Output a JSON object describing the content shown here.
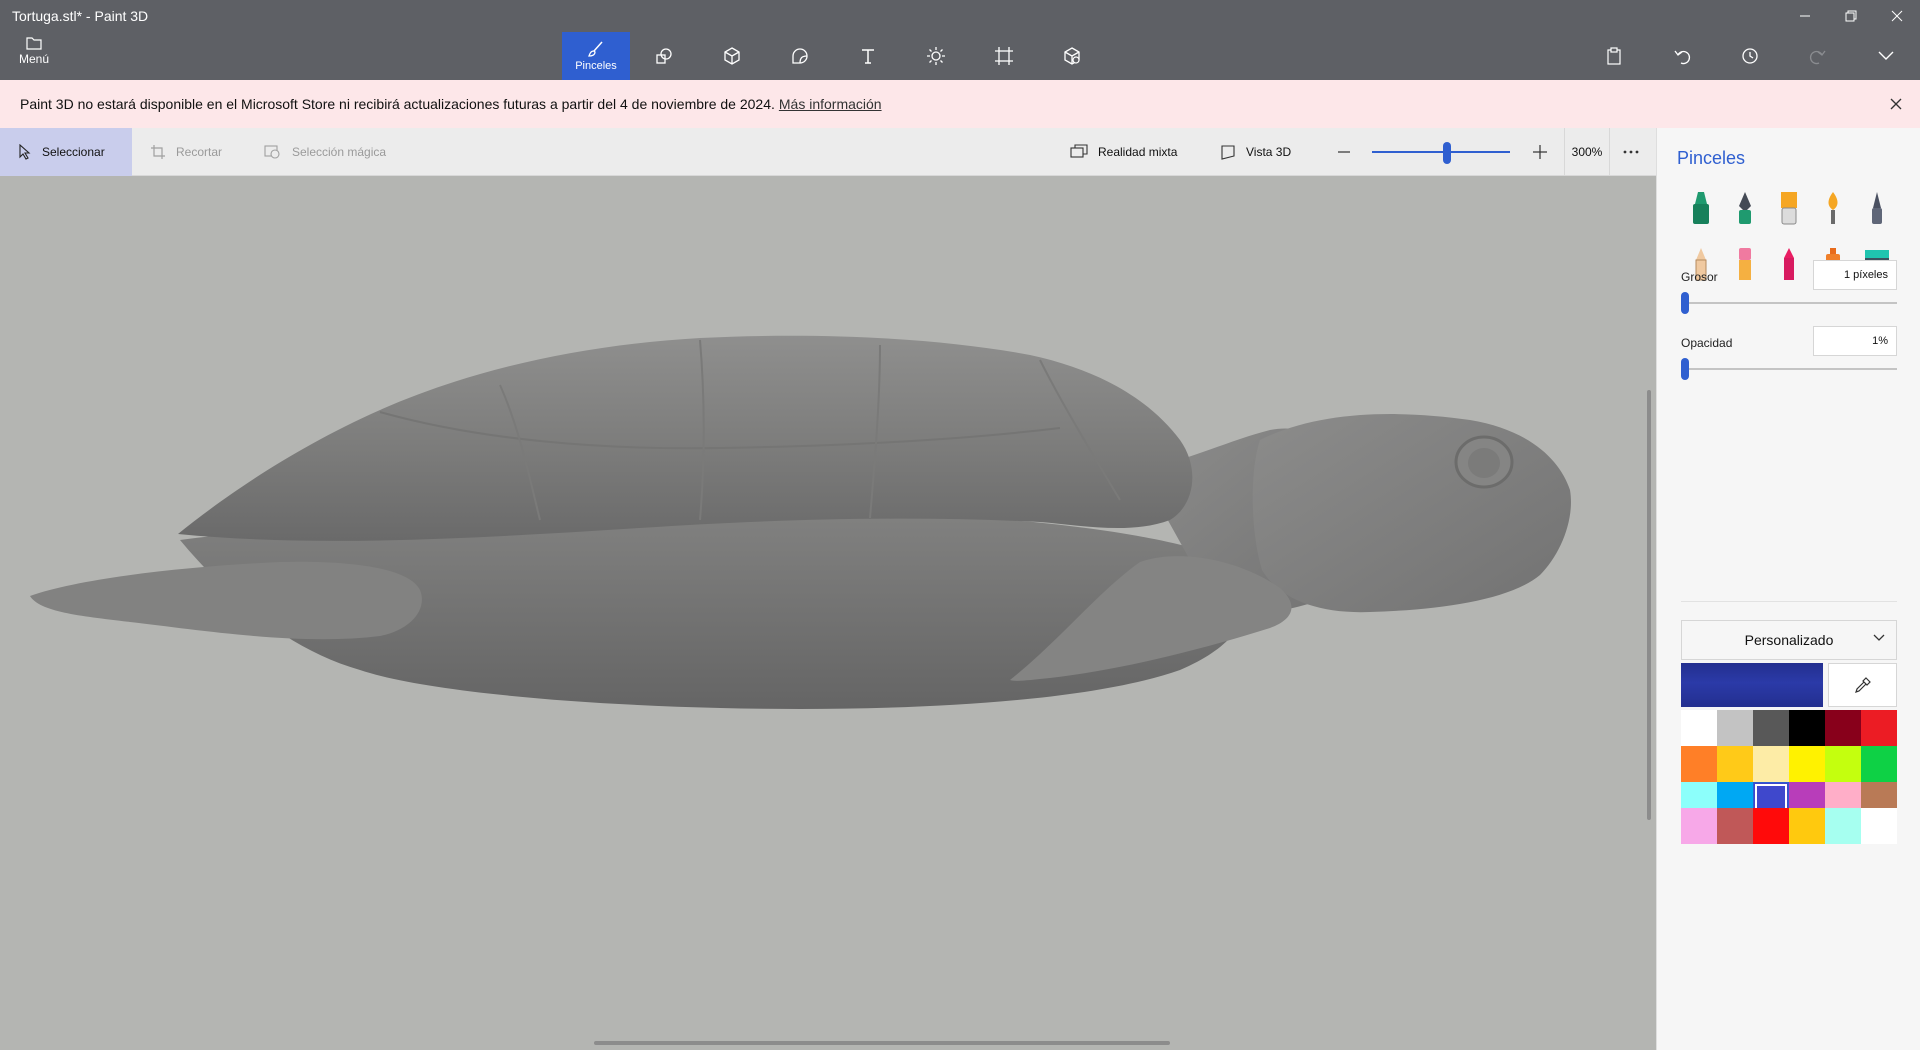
{
  "window": {
    "title": "Tortuga.stl* - Paint 3D"
  },
  "menu": {
    "label": "Menú"
  },
  "toolbar": {
    "tools": [
      {
        "label": "Pinceles",
        "icon": "brush-icon",
        "active": true
      },
      {
        "label": "",
        "icon": "shapes-2d-icon"
      },
      {
        "label": "",
        "icon": "shapes-3d-icon"
      },
      {
        "label": "",
        "icon": "stickers-icon"
      },
      {
        "label": "",
        "icon": "text-icon"
      },
      {
        "label": "",
        "icon": "effects-icon"
      },
      {
        "label": "",
        "icon": "canvas-icon"
      },
      {
        "label": "",
        "icon": "library-3d-icon"
      }
    ]
  },
  "banner": {
    "text": "Paint 3D no estará disponible en el Microsoft Store ni recibirá actualizaciones futuras a partir del 4 de noviembre de 2024.",
    "link": "Más información"
  },
  "subtoolbar": {
    "select": "Seleccionar",
    "crop": "Recortar",
    "magic_select": "Selección mágica",
    "mixed_reality": "Realidad mixta",
    "view_3d": "Vista 3D",
    "zoom": "300%"
  },
  "panel": {
    "title": "Pinceles",
    "brushes": [
      "marker",
      "calligraphy-pen",
      "oil-brush",
      "watercolor",
      "pixel-pen",
      "pencil",
      "eraser",
      "crayon",
      "spray-can",
      "fill"
    ],
    "thickness": {
      "label": "Grosor",
      "value": "1 píxeles",
      "level": 0
    },
    "opacity": {
      "label": "Opacidad",
      "value": "1%",
      "level": 0
    },
    "color_mode": "Personalizado",
    "current_color": "#232f8f",
    "palette": [
      "#ffffff",
      "#c3c3c3",
      "#585858",
      "#000000",
      "#88001b",
      "#ec1c24",
      "#ff7f27",
      "#ffca18",
      "#fdeca6",
      "#fff200",
      "#c4ff0e",
      "#0ed145",
      "#8cfffb",
      "#00a8f3",
      "#3f48cc",
      "#b83dba",
      "#ffaec8",
      "#b97a56"
    ],
    "selected_palette_index": 14,
    "custom_colors": [
      "#f7a8e8",
      "#c05858",
      "#ff0a0a",
      "#ffc90e",
      "#a6fff0",
      "#ffffff"
    ]
  }
}
